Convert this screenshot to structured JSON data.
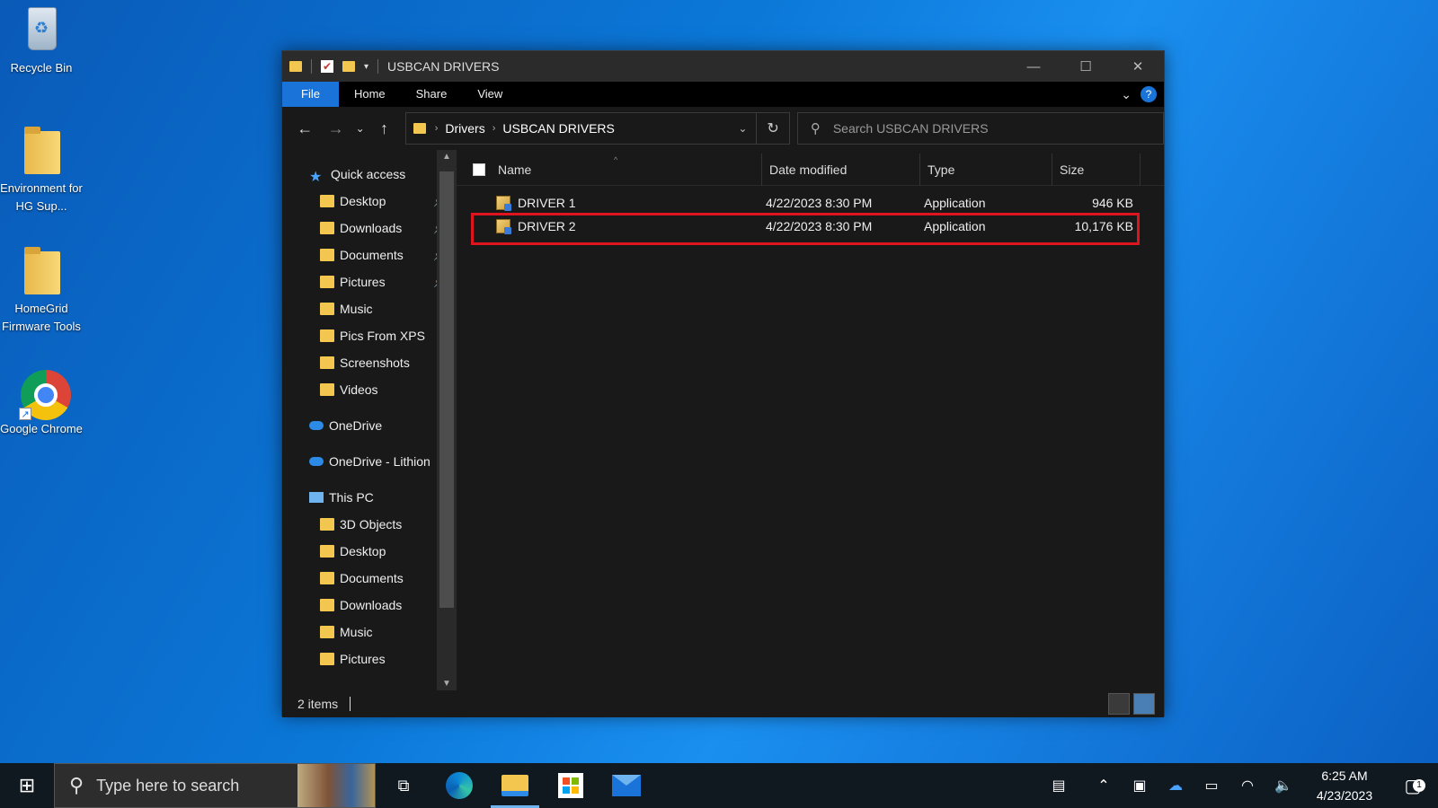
{
  "desktop": {
    "icons": [
      {
        "label": "Recycle Bin"
      },
      {
        "label": "Environment for HG Sup..."
      },
      {
        "label": "HomeGrid Firmware Tools"
      },
      {
        "label": "Google Chrome"
      }
    ]
  },
  "window": {
    "title": "USBCAN DRIVERS",
    "controls": {
      "minimize": "—",
      "maximize": "☐",
      "close": "✕"
    },
    "ribbon_tabs": [
      "File",
      "Home",
      "Share",
      "View"
    ],
    "address": {
      "crumbs": [
        "Drivers",
        "USBCAN DRIVERS"
      ]
    },
    "search_placeholder": "Search USBCAN DRIVERS",
    "nav_pane": {
      "quick_access": "Quick access",
      "quick_items": [
        {
          "label": "Desktop",
          "pinned": true
        },
        {
          "label": "Downloads",
          "pinned": true
        },
        {
          "label": "Documents",
          "pinned": true
        },
        {
          "label": "Pictures",
          "pinned": true
        },
        {
          "label": "Music",
          "pinned": false
        },
        {
          "label": "Pics From XPS",
          "pinned": false
        },
        {
          "label": "Screenshots",
          "pinned": false
        },
        {
          "label": "Videos",
          "pinned": false
        }
      ],
      "onedrive": "OneDrive",
      "onedrive_lithion": "OneDrive - Lithion",
      "this_pc": "This PC",
      "pc_items": [
        "3D Objects",
        "Desktop",
        "Documents",
        "Downloads",
        "Music",
        "Pictures"
      ]
    },
    "columns": {
      "name": "Name",
      "date": "Date modified",
      "type": "Type",
      "size": "Size"
    },
    "files": [
      {
        "name": "DRIVER 1",
        "date": "4/22/2023 8:30 PM",
        "type": "Application",
        "size": "946 KB"
      },
      {
        "name": "DRIVER 2",
        "date": "4/22/2023 8:30 PM",
        "type": "Application",
        "size": "10,176 KB"
      }
    ],
    "status": "2 items"
  },
  "taskbar": {
    "search_placeholder": "Type here to search",
    "time": "6:25 AM",
    "date": "4/23/2023",
    "notification_count": "1"
  }
}
